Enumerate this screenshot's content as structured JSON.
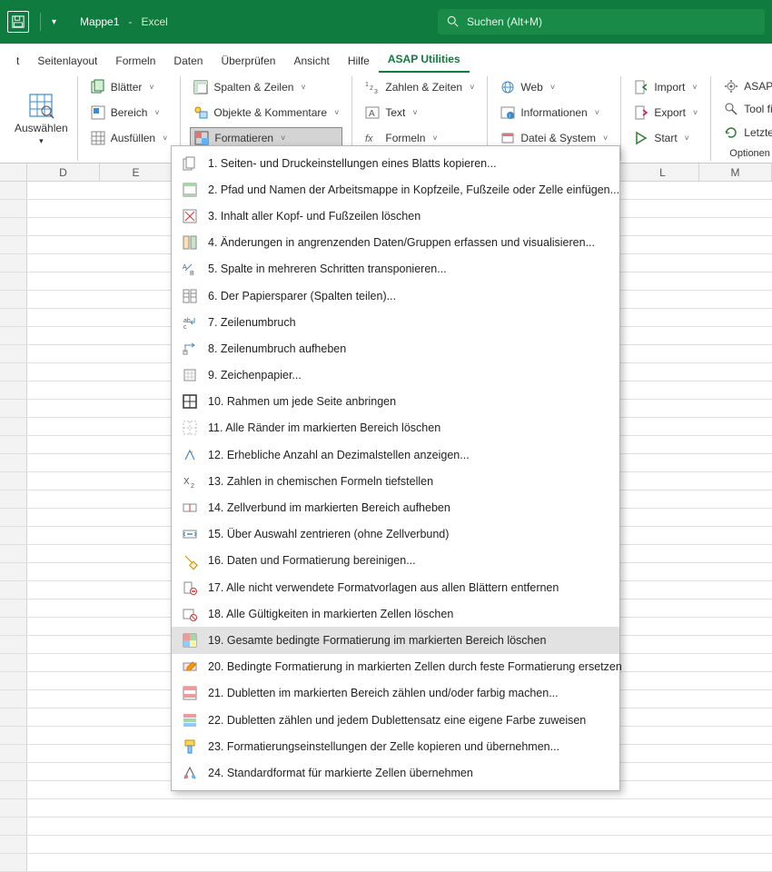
{
  "titlebar": {
    "doc_title": "Mappe1",
    "app_name": "Excel",
    "search_placeholder": "Suchen (Alt+M)"
  },
  "tabs": {
    "start": "t",
    "page_layout": "Seitenlayout",
    "formulas": "Formeln",
    "data": "Daten",
    "review": "Überprüfen",
    "view": "Ansicht",
    "help": "Hilfe",
    "asap": "ASAP Utilities"
  },
  "ribbon": {
    "select": "Auswählen",
    "sheets": "Blätter",
    "range": "Bereich",
    "fill": "Ausfüllen",
    "cols_rows": "Spalten & Zeilen",
    "objects_comments": "Objekte & Kommentare",
    "format": "Formatieren",
    "numbers_dates": "Zahlen & Zeiten",
    "text": "Text",
    "formulas": "Formeln",
    "web": "Web",
    "information": "Informationen",
    "file_system": "Datei & System",
    "import": "Import",
    "export": "Export",
    "start": "Start",
    "asap_options": "ASAP Utilities O",
    "find_tool": "Tool finden und",
    "last_tool": "Letztes Tool ern",
    "options": "Optionen und Ein"
  },
  "columns": {
    "c1": "D",
    "c2": "E",
    "c3": "L",
    "c4": "M"
  },
  "menu": {
    "m1": "1. Seiten- und Druckeinstellungen eines Blatts kopieren...",
    "m2": "2. Pfad und Namen der Arbeitsmappe in Kopfzeile, Fußzeile oder Zelle einfügen...",
    "m3": "3. Inhalt aller Kopf- und Fußzeilen löschen",
    "m4": "4. Änderungen in angrenzenden Daten/Gruppen erfassen und visualisieren...",
    "m5": "5. Spalte in mehreren Schritten transponieren...",
    "m6": "6. Der Papiersparer (Spalten teilen)...",
    "m7": "7. Zeilenumbruch",
    "m8": "8. Zeilenumbruch aufheben",
    "m9": "9. Zeichenpapier...",
    "m10": "10. Rahmen um jede Seite anbringen",
    "m11": "11. Alle Ränder im markierten Bereich löschen",
    "m12": "12. Erhebliche Anzahl an Dezimalstellen anzeigen...",
    "m13": "13. Zahlen in chemischen Formeln tiefstellen",
    "m14": "14. Zellverbund im markierten Bereich aufheben",
    "m15": "15. Über Auswahl zentrieren (ohne Zellverbund)",
    "m16": "16. Daten und Formatierung bereinigen...",
    "m17": "17. Alle nicht verwendete Formatvorlagen aus allen Blättern entfernen",
    "m18": "18. Alle Gültigkeiten in markierten Zellen löschen",
    "m19": "19. Gesamte bedingte Formatierung im markierten Bereich löschen",
    "m20": "20. Bedingte Formatierung in markierten Zellen durch feste Formatierung ersetzen",
    "m21": "21. Dubletten im markierten Bereich zählen und/oder farbig machen...",
    "m22": "22. Dubletten zählen und jedem Dublettensatz eine eigene Farbe zuweisen",
    "m23": "23. Formatierungseinstellungen der Zelle kopieren und übernehmen...",
    "m24": "24. Standardformat für markierte Zellen übernehmen"
  }
}
